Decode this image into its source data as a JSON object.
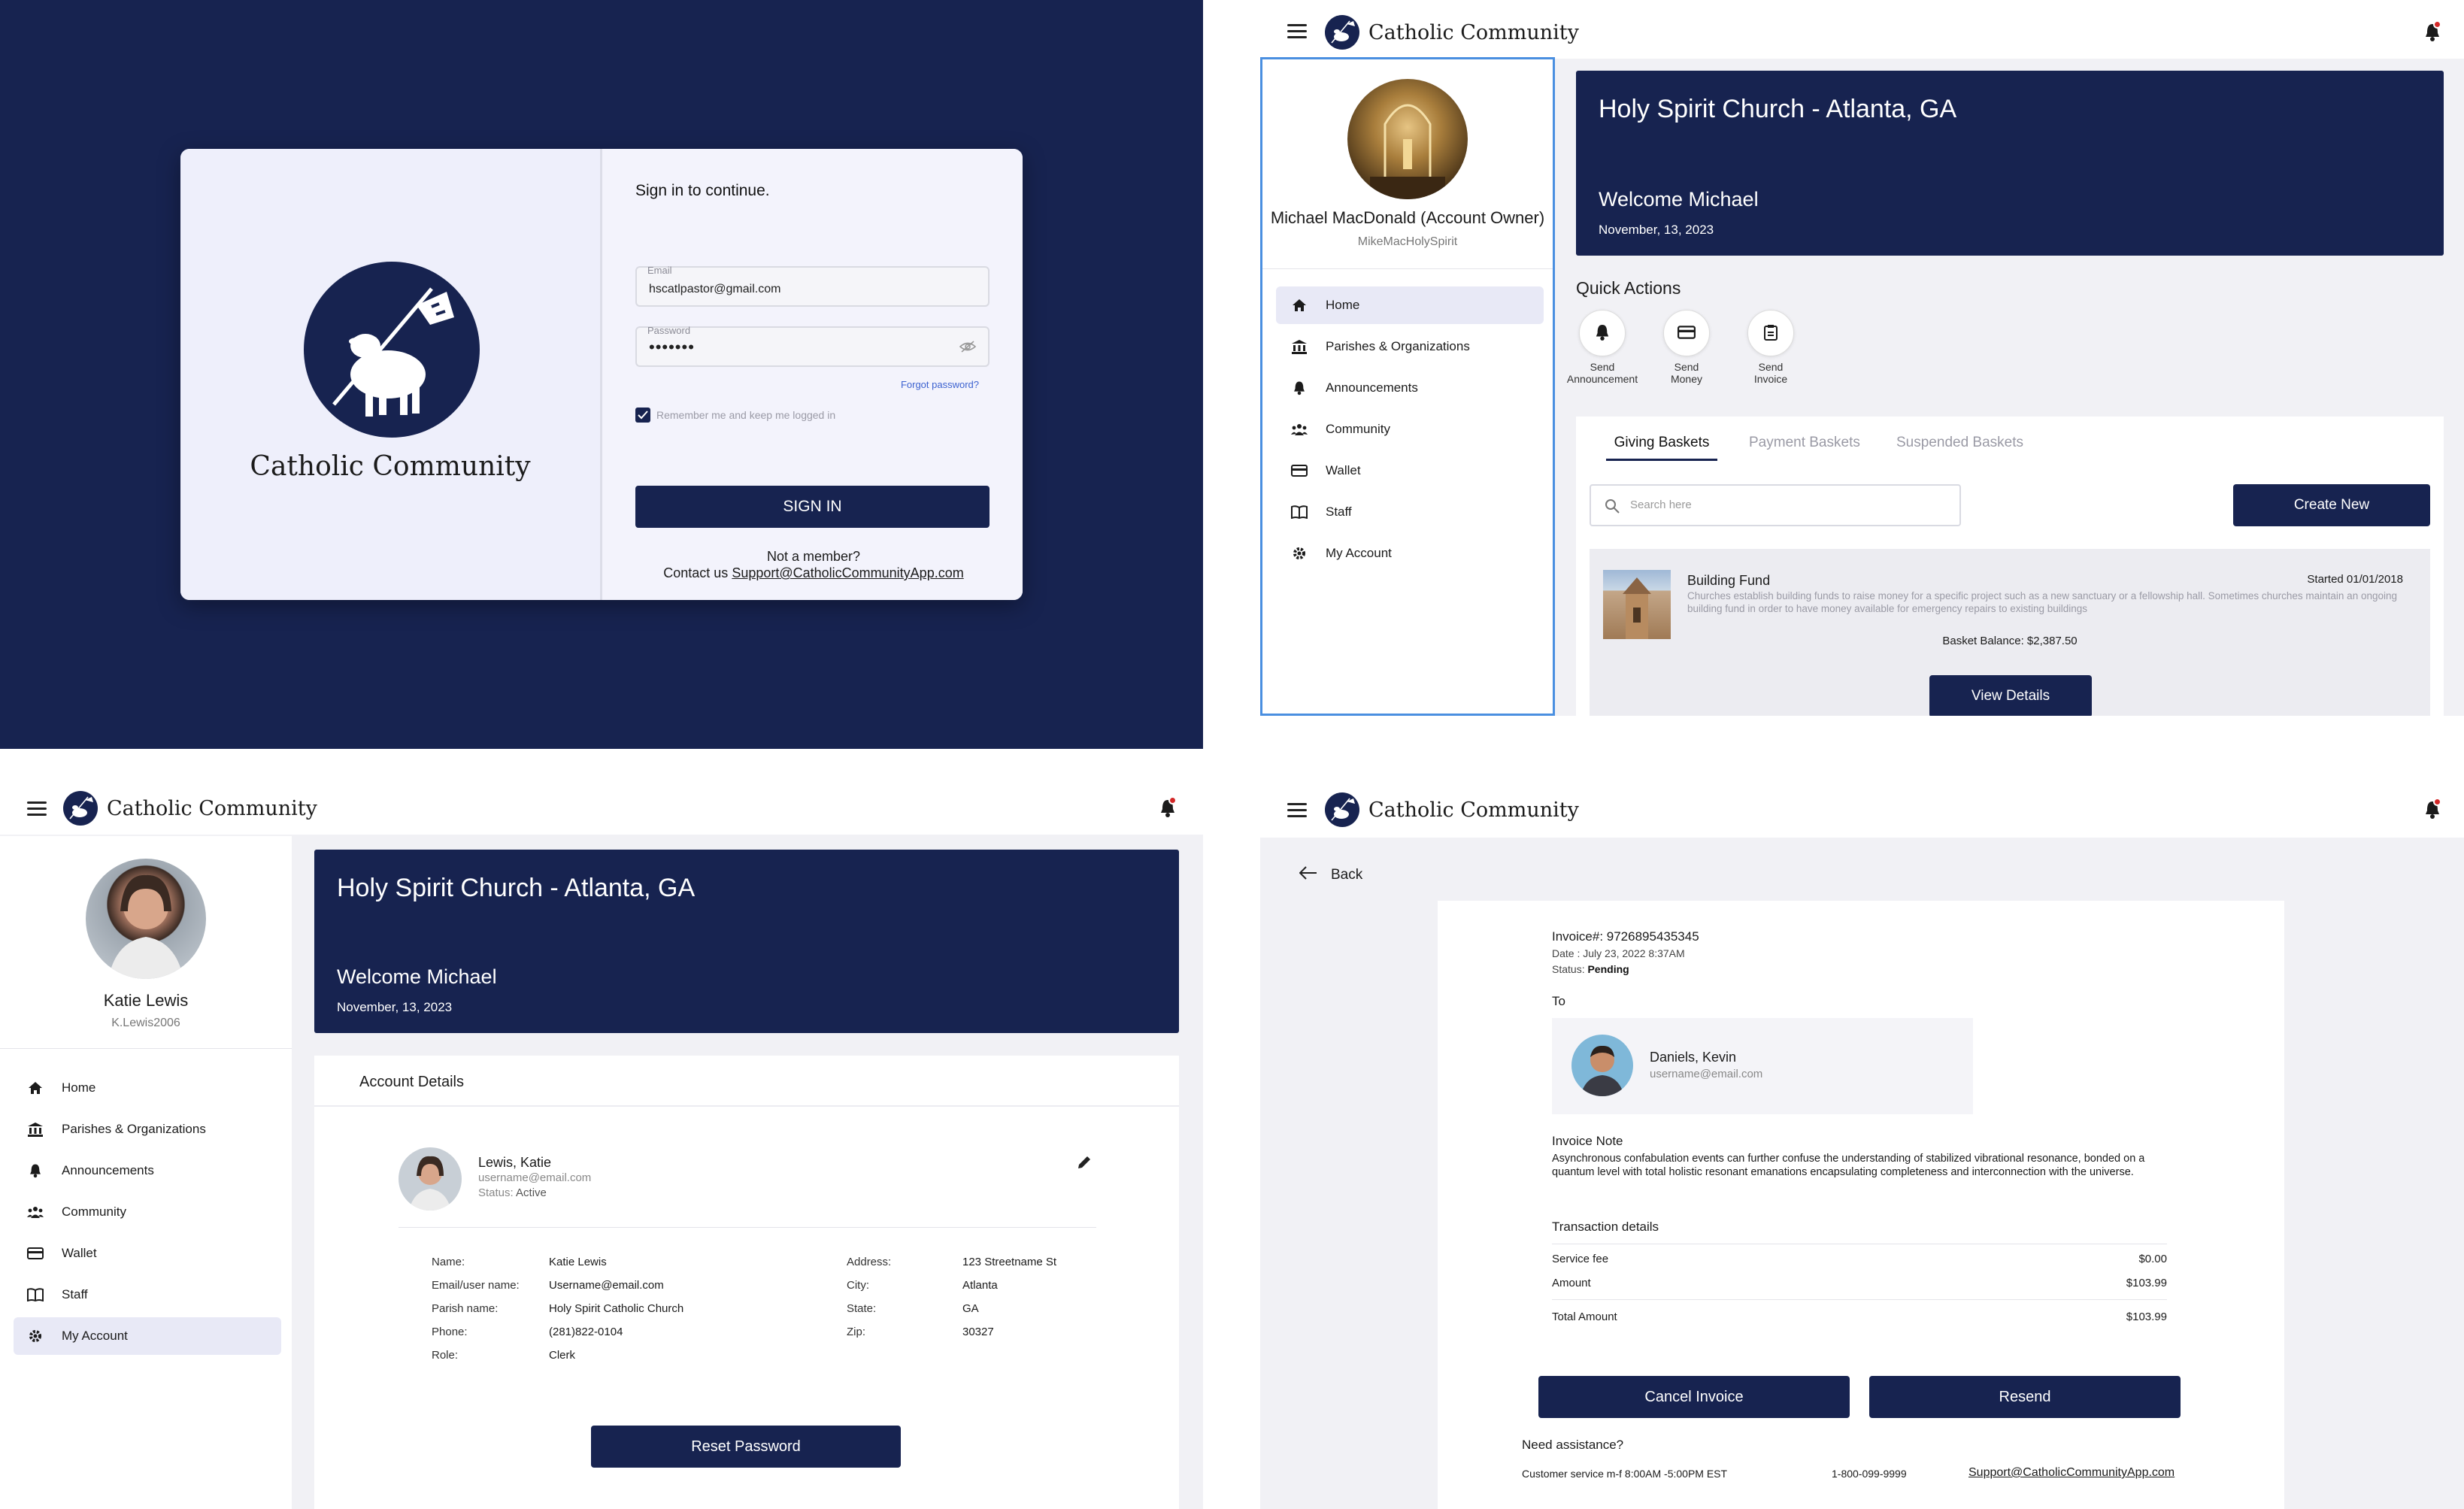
{
  "brand_name": "Catholic Community",
  "colors": {
    "navy": "#172350",
    "page_bg": "#f0f1f5",
    "accent_blue": "#3c62d0"
  },
  "login": {
    "heading": "Sign in to continue.",
    "email_label": "Email",
    "email_value": "hscatlpastor@gmail.com",
    "password_label": "Password",
    "password_value": "•••••••",
    "forgot": "Forgot password?",
    "remember": "Remember me and keep me logged in",
    "signin": "SIGN IN",
    "not_member": "Not a member?",
    "contact_prefix": "Contact us ",
    "contact_email": "Support@CatholicCommunityApp.com"
  },
  "nav": {
    "home": "Home",
    "parishes": "Parishes & Organizations",
    "announcements": "Announcements",
    "community": "Community",
    "wallet": "Wallet",
    "staff": "Staff",
    "account": "My Account"
  },
  "dashboard": {
    "profile_name": "Michael MacDonald (Account Owner)",
    "profile_user": "MikeMacHolySpirit",
    "church": "Holy Spirit Church - Atlanta, GA",
    "welcome": "Welcome Michael",
    "date": "November, 13, 2023",
    "quick_actions": "Quick Actions",
    "qa1": [
      "Send",
      "Announcement"
    ],
    "qa2": [
      "Send",
      "Money"
    ],
    "qa3": [
      "Send",
      "Invoice"
    ],
    "tabs": [
      "Giving Baskets",
      "Payment Baskets",
      "Suspended Baskets"
    ],
    "search_placeholder": "Search here",
    "create_new": "Create New",
    "basket_title": "Building Fund",
    "basket_started": "Started 01/01/2018",
    "basket_desc": "Churches establish building funds to raise money for a specific project such as a new sanctuary or a fellowship hall. Sometimes churches maintain an ongoing building fund in order to have money available for emergency repairs to existing buildings",
    "basket_balance": "Basket Balance: $2,387.50",
    "view_details": "View Details"
  },
  "account": {
    "profile_name": "Katie Lewis",
    "profile_user": "K.Lewis2006",
    "section_title": "Account Details",
    "card_name": "Lewis, Katie",
    "card_email": "username@email.com",
    "status_label": "Status:",
    "status_value": "Active",
    "fields_left": [
      {
        "k": "Name:",
        "v": "Katie Lewis"
      },
      {
        "k": "Email/user name:",
        "v": "Username@email.com"
      },
      {
        "k": "Parish name:",
        "v": "Holy Spirit Catholic Church"
      },
      {
        "k": "Phone:",
        "v": "(281)822-0104"
      },
      {
        "k": "Role:",
        "v": "Clerk"
      }
    ],
    "fields_right": [
      {
        "k": "Address:",
        "v": "123 Streetname St"
      },
      {
        "k": "City:",
        "v": "Atlanta"
      },
      {
        "k": "State:",
        "v": "GA"
      },
      {
        "k": "Zip:",
        "v": "30327"
      }
    ],
    "reset": "Reset Password"
  },
  "invoice": {
    "back": "Back",
    "number": "Invoice#: 9726895435345",
    "date": "Date : July 23, 2022 8:37AM",
    "status_label": "Status: ",
    "status_value": "Pending",
    "to": "To",
    "recipient_name": "Daniels, Kevin",
    "recipient_email": "username@email.com",
    "note_title": "Invoice Note",
    "note": "Asynchronous confabulation events can further confuse the understanding of stabilized vibrational resonance, bonded on a quantum level with total holistic resonant emanations encapsulating completeness and interconnection with the universe.",
    "tx_title": "Transaction details",
    "tx": [
      {
        "k": "Service fee",
        "v": "$0.00"
      },
      {
        "k": "Amount",
        "v": "$103.99"
      }
    ],
    "total_label": "Total Amount",
    "total_value": "$103.99",
    "cancel": "Cancel Invoice",
    "resend": "Resend",
    "assist": "Need assistance?",
    "hours": "Customer service m-f 8:00AM -5:00PM EST",
    "phone": "1-800-099-9999",
    "email": "Support@CatholicCommunityApp.com"
  }
}
